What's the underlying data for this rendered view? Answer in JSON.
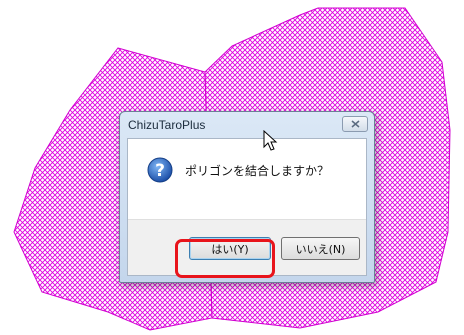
{
  "map": {
    "hatch_color": "#e000e0",
    "background": "#ffffff"
  },
  "dialog": {
    "title": "ChizuTaroPlus",
    "message": "ポリゴンを結合しますか？",
    "icon": "question-icon",
    "yes_label": "はい(Y)",
    "no_label": "いいえ(N)",
    "close_icon": "close-icon"
  },
  "annotation": {
    "highlight_color": "#e8141b",
    "highlight_target": "yes-button"
  },
  "cursor": {
    "icon": "mouse-pointer-icon"
  }
}
